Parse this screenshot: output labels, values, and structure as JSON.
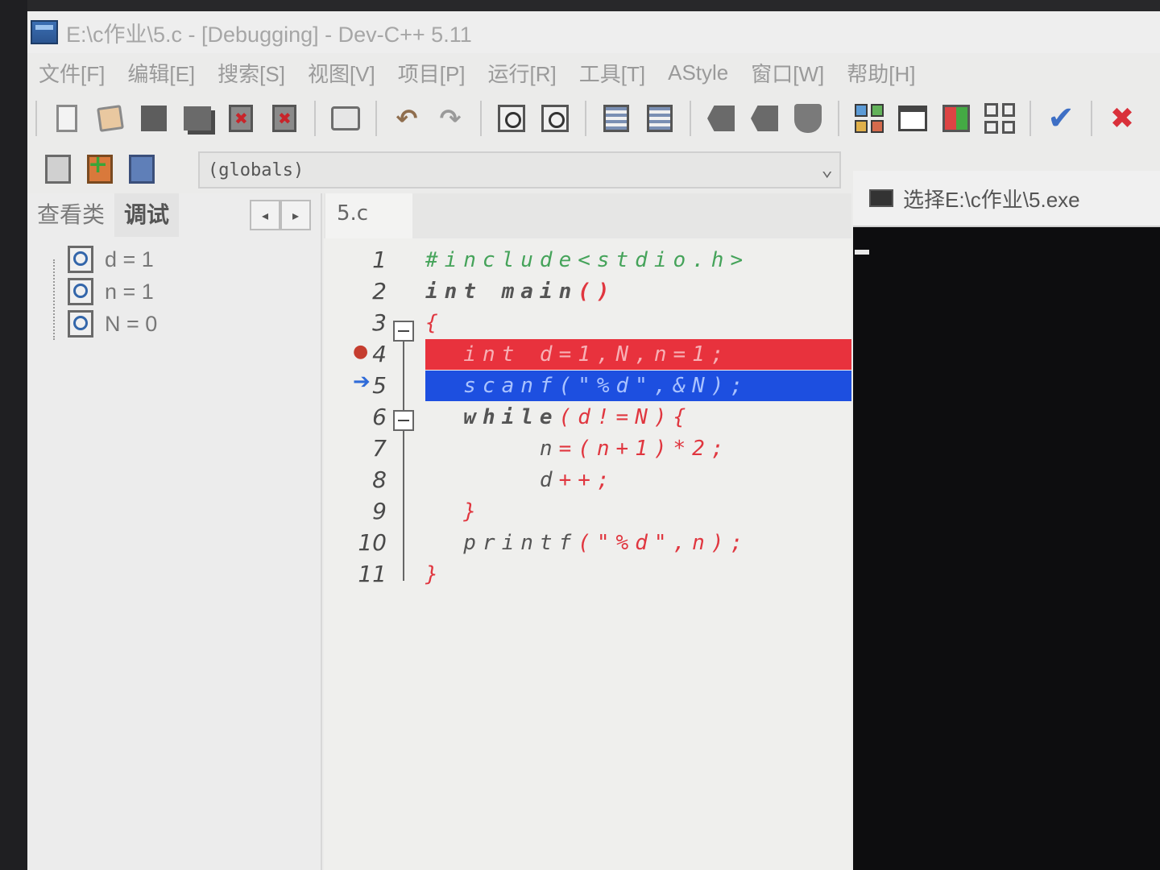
{
  "window": {
    "title": "E:\\c作业\\5.c - [Debugging] - Dev-C++ 5.11"
  },
  "menu": [
    "文件[F]",
    "编辑[E]",
    "搜索[S]",
    "视图[V]",
    "项目[P]",
    "运行[R]",
    "工具[T]",
    "AStyle",
    "窗口[W]",
    "帮助[H]"
  ],
  "toolbar2": {
    "scope_combo": "(globals)"
  },
  "left_panel": {
    "tabs": [
      "查看类",
      "调试"
    ],
    "active_tab": "调试",
    "nav_prev": "◂",
    "nav_next": "▸",
    "watches": [
      {
        "text": "d = 1"
      },
      {
        "text": "n = 1"
      },
      {
        "text": "N = 0"
      }
    ]
  },
  "editor": {
    "file_tab": "5.c",
    "line_numbers": [
      "1",
      "2",
      "3",
      "4",
      "5",
      "6",
      "7",
      "8",
      "9",
      "10",
      "11"
    ],
    "breakpoint_line": 4,
    "current_line": 5,
    "lines": {
      "l1": "#include<stdio.h>",
      "l2a": "int",
      "l2b": " main",
      "l2c": "()",
      "l3": "{",
      "l4": "  int d=1,N,n=1;",
      "l5": "  scanf(\"%d\",&N);",
      "l6a": "  while",
      "l6b": "(d!=N){",
      "l7a": "      n",
      "l7b": "=(n+1)*2;",
      "l8a": "      d",
      "l8b": "++;",
      "l9": "  }",
      "l10a": "  printf",
      "l10b": "(\"%d\",n);",
      "l11": "}"
    }
  },
  "console": {
    "title": "选择E:\\c作业\\5.exe"
  }
}
